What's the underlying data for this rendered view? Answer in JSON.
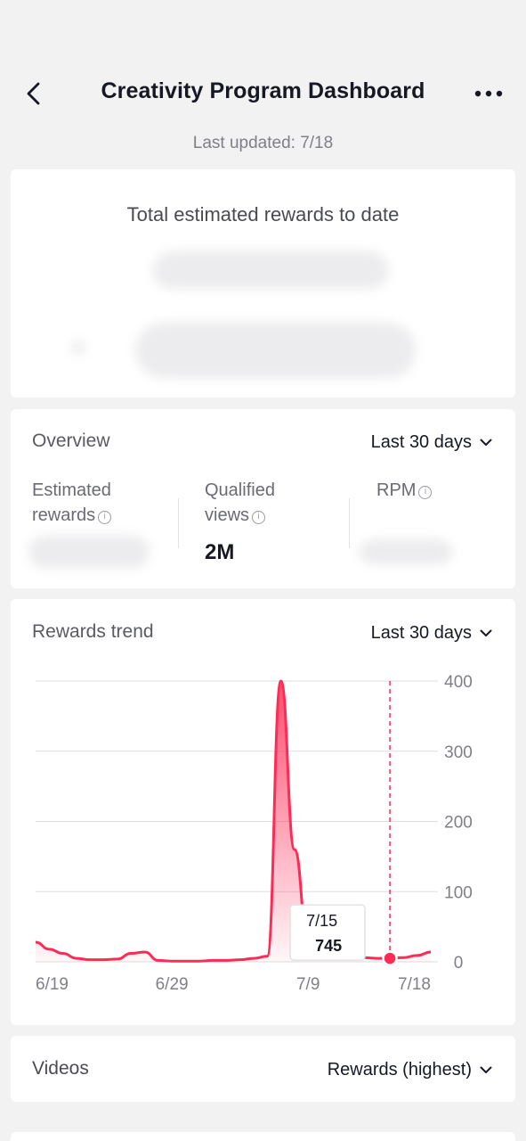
{
  "header": {
    "title": "Creativity Program Dashboard",
    "last_updated": "Last updated: 7/18"
  },
  "rewards": {
    "title": "Total estimated rewards to date"
  },
  "overview": {
    "heading": "Overview",
    "range": "Last 30 days",
    "metrics": [
      {
        "label_line1": "Estimated",
        "label_line2": "rewards",
        "value": ""
      },
      {
        "label_line1": "Qualified",
        "label_line2": "views",
        "value": "2M"
      },
      {
        "label_line1": "RPM",
        "label_line2": "",
        "value": ""
      }
    ]
  },
  "trend": {
    "heading": "Rewards trend",
    "range": "Last 30 days",
    "tooltip": {
      "date": "7/15",
      "value": "745"
    }
  },
  "videos": {
    "heading": "Videos",
    "sort": "Rewards (highest)"
  },
  "chart_data": {
    "type": "area",
    "x": [
      "6/19",
      "6/20",
      "6/21",
      "6/22",
      "6/23",
      "6/24",
      "6/25",
      "6/26",
      "6/27",
      "6/28",
      "6/29",
      "6/30",
      "7/1",
      "7/2",
      "7/3",
      "7/4",
      "7/5",
      "7/6",
      "7/7",
      "7/8",
      "7/9",
      "7/10",
      "7/11",
      "7/12",
      "7/13",
      "7/14",
      "7/15",
      "7/16",
      "7/17",
      "7/18"
    ],
    "values": [
      28,
      18,
      12,
      5,
      3,
      3,
      4,
      12,
      14,
      2,
      1,
      1,
      1,
      2,
      2,
      3,
      5,
      8,
      400,
      160,
      30,
      16,
      10,
      8,
      6,
      5,
      5,
      6,
      9,
      14
    ],
    "xticks": [
      "6/19",
      "6/29",
      "7/9",
      "7/18"
    ],
    "yticks": [
      0,
      100,
      200,
      300,
      400
    ],
    "ylim": [
      0,
      400
    ],
    "highlight_index": 26,
    "color": "#fe2c55"
  }
}
